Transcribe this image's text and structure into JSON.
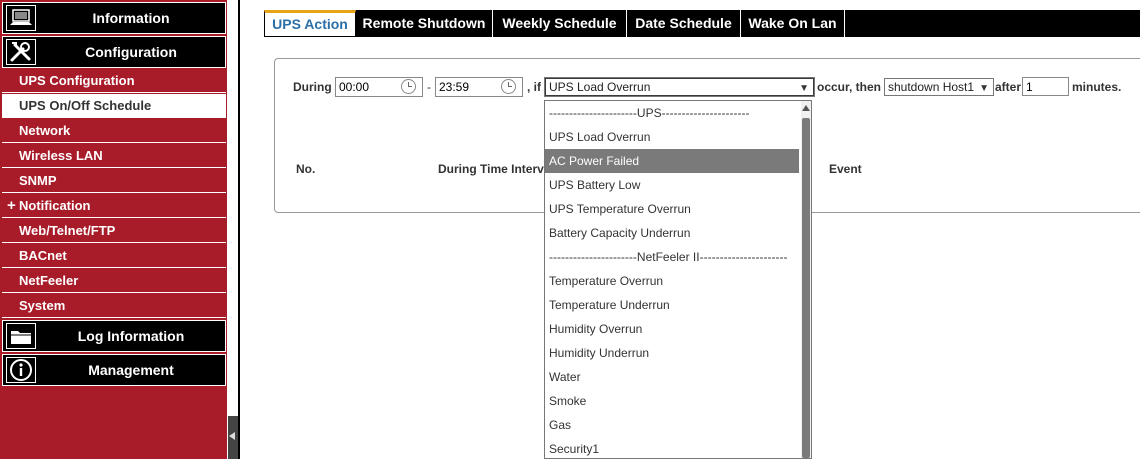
{
  "sidebar": {
    "sections": {
      "information": "Information",
      "configuration": "Configuration",
      "log_information": "Log Information",
      "management": "Management"
    },
    "config_items": [
      "UPS Configuration",
      "UPS On/Off Schedule",
      "Network",
      "Wireless LAN",
      "SNMP",
      "Notification",
      "Web/Telnet/FTP",
      "BACnet",
      "NetFeeler",
      "System"
    ],
    "notification_prefix": "+"
  },
  "tabs": [
    "UPS Action",
    "Remote Shutdown",
    "Weekly Schedule",
    "Date Schedule",
    "Wake On Lan"
  ],
  "form": {
    "during_label": "During",
    "start_time": "00:00",
    "dash": "-",
    "end_time": "23:59",
    "if_label": ", if",
    "event_selected": "UPS Load Overrun",
    "occur_label": "occur, then",
    "action_selected": "shutdown Host1",
    "after_label": "after",
    "after_value": "1",
    "minutes_label": "minutes."
  },
  "table_headers": {
    "no": "No.",
    "interval": "During Time Interv",
    "event": "Event"
  },
  "dropdown_options": [
    "----------------------UPS----------------------",
    "UPS Load Overrun",
    "AC Power Failed",
    "UPS Battery Low",
    "UPS Temperature Overrun",
    "Battery Capacity Underrun",
    "----------------------NetFeeler II----------------------",
    "Temperature Overrun",
    "Temperature Underrun",
    "Humidity Overrun",
    "Humidity Underrun",
    "Water",
    "Smoke",
    "Gas",
    "Security1"
  ],
  "colors": {
    "sidebar_red": "#a81b29",
    "header_black": "#000000",
    "tab_active_text": "#2a6fa8",
    "tab_active_accent": "#e8a317",
    "highlight_gray": "#7a7a7a"
  },
  "icons": {
    "information": "laptop-icon",
    "configuration": "tools-icon",
    "log_information": "folder-icon",
    "management": "info-icon"
  }
}
